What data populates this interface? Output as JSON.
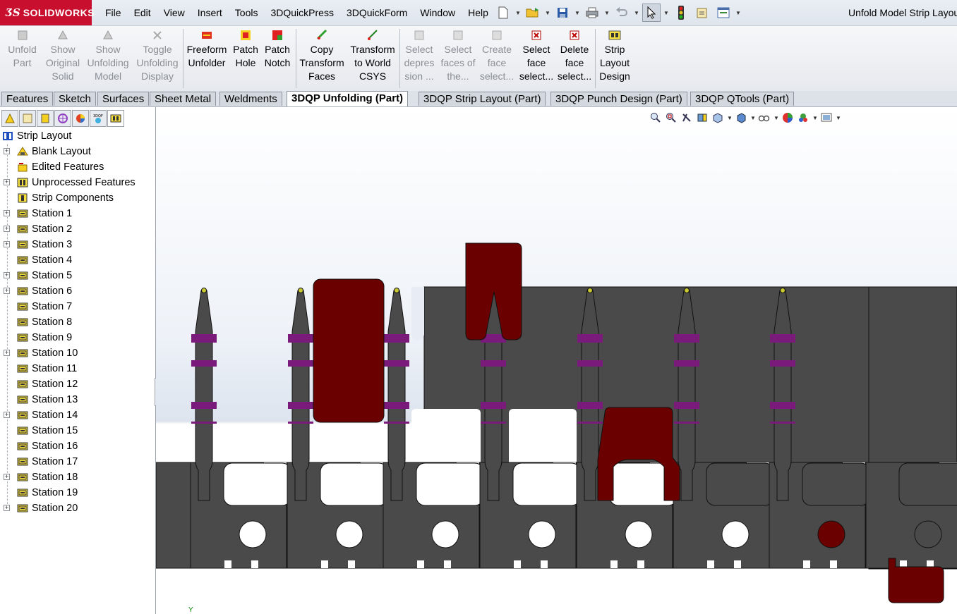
{
  "app": {
    "logo_text": "SOLIDWORKS",
    "logo_prefix": "3S",
    "document_title": "Unfold Model Strip Layou"
  },
  "menu": [
    "File",
    "Edit",
    "View",
    "Insert",
    "Tools",
    "3DQuickPress",
    "3DQuickForm",
    "Window",
    "Help"
  ],
  "quick_toolbar": [
    "new-document-icon",
    "open-folder-icon",
    "save-icon",
    "print-icon",
    "undo-icon",
    "select-arrow-icon",
    "rebuild-traffic-light-icon",
    "file-properties-icon",
    "options-icon"
  ],
  "command_manager": {
    "unfold_part": "Unfold Part",
    "show_original_solid": "Show Original Solid",
    "show_unfolding_model": "Show Unfolding Model",
    "toggle_unfolding_display": "Toggle Unfolding Display",
    "freeform_unfolder": "Freeform Unfolder",
    "patch_hole": "Patch Hole",
    "patch_notch": "Patch Notch",
    "copy_transform_faces": "Copy Transform Faces",
    "transform_to_world_csys": "Transform to World CSYS",
    "select_depression": "Select depres sion ...",
    "select_faces_of_the": "Select faces of the...",
    "create_face_select": "Create face select...",
    "select_face_select": "Select face select...",
    "delete_face_select": "Delete face select...",
    "strip_layout_design": "Strip Layout Design"
  },
  "tabs": [
    "Features",
    "Sketch",
    "Surfaces",
    "Sheet Metal",
    "Weldments",
    "3DQP Unfolding (Part)",
    "3DQP Strip Layout (Part)",
    "3DQP Punch Design (Part)",
    "3DQP QTools (Part)"
  ],
  "active_tab": "3DQP Unfolding (Part)",
  "tree": {
    "root": "Strip Layout",
    "items": [
      {
        "label": "Blank Layout",
        "expandable": true
      },
      {
        "label": "Edited Features",
        "expandable": false
      },
      {
        "label": "Unprocessed Features",
        "expandable": true
      },
      {
        "label": "Strip Components",
        "expandable": false
      },
      {
        "label": "Station 1",
        "expandable": true
      },
      {
        "label": "Station 2",
        "expandable": true
      },
      {
        "label": "Station 3",
        "expandable": true
      },
      {
        "label": "Station 4",
        "expandable": false
      },
      {
        "label": "Station 5",
        "expandable": true
      },
      {
        "label": "Station 6",
        "expandable": true
      },
      {
        "label": "Station 7",
        "expandable": false
      },
      {
        "label": "Station 8",
        "expandable": false
      },
      {
        "label": "Station 9",
        "expandable": false
      },
      {
        "label": "Station 10",
        "expandable": true
      },
      {
        "label": "Station 11",
        "expandable": false
      },
      {
        "label": "Station 12",
        "expandable": false
      },
      {
        "label": "Station 13",
        "expandable": false
      },
      {
        "label": "Station 14",
        "expandable": true
      },
      {
        "label": "Station 15",
        "expandable": false
      },
      {
        "label": "Station 16",
        "expandable": false
      },
      {
        "label": "Station 17",
        "expandable": false
      },
      {
        "label": "Station 18",
        "expandable": true
      },
      {
        "label": "Station 19",
        "expandable": false
      },
      {
        "label": "Station 20",
        "expandable": true
      }
    ]
  },
  "graphics": {
    "triad_label": "Y",
    "colors": {
      "strip": "#4a4a4a",
      "punch": "#6b0000",
      "band": "#7a1a7a",
      "pilot": "#c8c832"
    }
  }
}
